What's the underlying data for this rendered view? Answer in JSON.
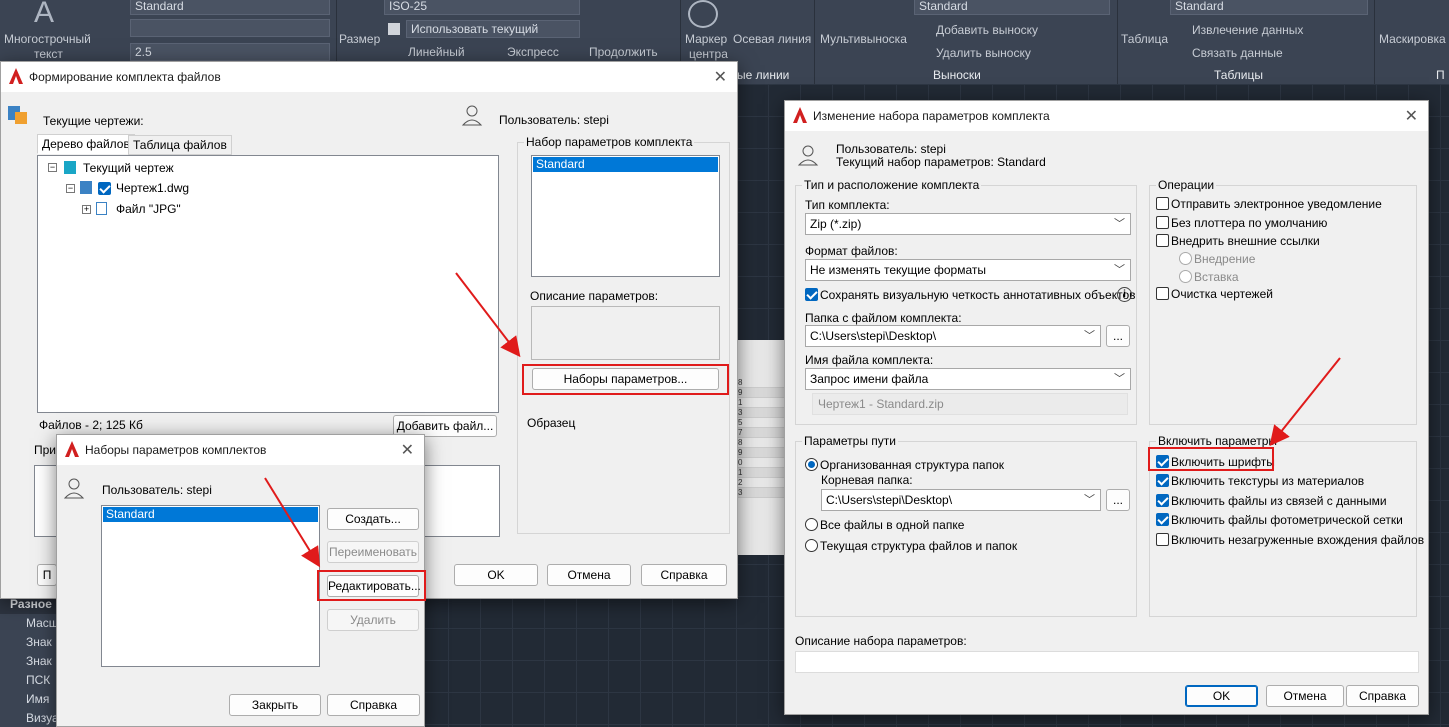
{
  "ribbon": {
    "mtext_label": "Многострочный",
    "mtext_label2": "текст",
    "text_style": "Standard",
    "text_height": "2.5",
    "dim_label": "Размер",
    "dim_style": "ISO-25",
    "use_current": "Использовать текущий",
    "linear": "Линейный",
    "express": "Экспресс",
    "continue": "Продолжить",
    "center_mark": "Маркер",
    "center_mark2": "центра",
    "center_line": "Осевая линия",
    "multileader": "Мультивыноска",
    "leader_style": "Standard",
    "add_leader": "Добавить выноску",
    "remove_leader": "Удалить выноску",
    "table_btn": "Таблица",
    "table_style": "Standard",
    "extract_data": "Извлечение данных",
    "link_data": "Связать данные",
    "masking": "Маскировка",
    "panel_lines": "ые линии",
    "panel_leaders": "Выноски",
    "panel_tables": "Таблицы",
    "panel_p": "П"
  },
  "props": {
    "header": "Разное",
    "rows": [
      "Масш",
      "Знак",
      "Знак",
      "ПСК",
      "Имя",
      "Визуа"
    ]
  },
  "etransmit": {
    "title": "Формирование комплекта файлов",
    "current_drawings": "Текущие чертежи:",
    "user": "Пользователь: stepi",
    "tab_tree": "Дерево файлов",
    "tab_table": "Таблица файлов",
    "tree": [
      "Текущий чертеж",
      "Чертеж1.dwg",
      "Файл \"JPG\""
    ],
    "files_info": "Файлов - 2; 125 Кб",
    "add_file": "Добавить файл...",
    "notes_label": "При",
    "setup_group": "Набор параметров комплекта",
    "setup_selected": "Standard",
    "desc_label": "Описание параметров:",
    "setups_button": "Наборы параметров...",
    "sample_label": "Образец",
    "bottom_left": "П",
    "ok": "OK",
    "cancel": "Отмена",
    "help": "Справка"
  },
  "setups": {
    "title": "Наборы параметров комплектов",
    "user": "Пользователь: stepi",
    "selected": "Standard",
    "create": "Создать...",
    "rename": "Переименовать",
    "edit": "Редактировать...",
    "delete": "Удалить",
    "close": "Закрыть",
    "help": "Справка"
  },
  "modify": {
    "title": "Изменение набора параметров комплекта",
    "user": "Пользователь: stepi",
    "current_setup": "Текущий набор параметров: Standard",
    "type_group": "Тип и расположение комплекта",
    "type_label": "Тип комплекта:",
    "type_value": "Zip (*.zip)",
    "format_label": "Формат файлов:",
    "format_value": "Не изменять текущие форматы",
    "keep_fidelity": "Сохранять визуальную четкость аннотативных объектов",
    "folder_label": "Папка с файлом комплекта:",
    "folder_value": "C:\\Users\\stepi\\Desktop\\",
    "filename_label": "Имя файла комплекта:",
    "filename_value": "Запрос имени файла",
    "filename_preview": "Чертеж1 - Standard.zip",
    "browse": "...",
    "ops_group": "Операции",
    "ops": [
      "Отправить электронное уведомление",
      "Без плоттера по умолчанию",
      "Внедрить внешние ссылки"
    ],
    "bind": "Внедрение",
    "insert": "Вставка",
    "purge": "Очистка чертежей",
    "path_group": "Параметры пути",
    "organized": "Организованная структура папок",
    "root_label": "Корневая папка:",
    "root_value": "C:\\Users\\stepi\\Desktop\\",
    "all_one": "Все файлы в одной папке",
    "keep_struct": "Текущая структура файлов и папок",
    "include_group": "Включить параметры",
    "include": [
      "Включить шрифты",
      "Включить текстуры из материалов",
      "Включить файлы из связей с данными",
      "Включить файлы фотометрической сетки",
      "Включить незагруженные вхождения файлов"
    ],
    "desc_label": "Описание набора параметров:",
    "ok": "OK",
    "cancel": "Отмена",
    "help": "Справка"
  },
  "preview_rows": [
    "8",
    "9",
    "1",
    "3",
    "5",
    "7",
    "8",
    "9",
    "0",
    "1",
    "2",
    "3"
  ],
  "colors": {
    "accent": "#0078d7",
    "highlight": "#e01b1b"
  }
}
